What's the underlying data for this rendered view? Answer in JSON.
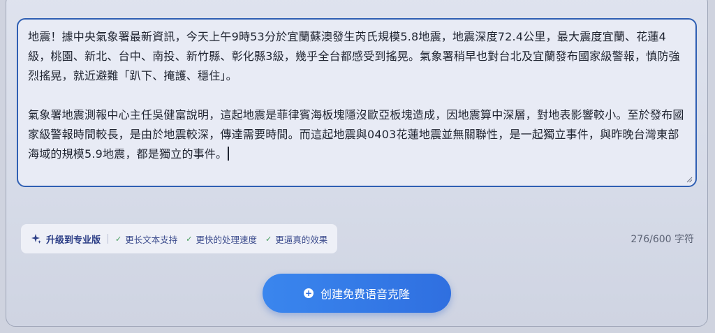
{
  "editor": {
    "paragraph_1": "地震！據中央氣象署最新資訊，今天上午9時53分於宜蘭蘇澳發生芮氏規模5.8地震，地震深度72.4公里，最大震度宜蘭、花蓮4級，桃園、新北、台中、南投、新竹縣、彰化縣3級，幾乎全台都感受到搖晃。氣象署稍早也對台北及宜蘭發布國家級警報，慎防強烈搖晃，就近避難「趴下、掩護、穩住」。",
    "paragraph_2": "氣象署地震測報中心主任吳健富說明，這起地震是菲律賓海板塊隱沒歐亞板塊造成，因地震算中深層，對地表影響較小。至於發布國家級警報時間較長，是由於地震較深，傳達需要時間。而這起地震與0403花蓮地震並無關聯性，是一起獨立事件，與昨晚台灣東部海域的規模5.9地震，都是獨立的事件。"
  },
  "features": {
    "upgrade_label": "升级到专业版",
    "items": [
      "更长文本支持",
      "更快的处理速度",
      "更逼真的效果"
    ],
    "check_glyph": "✓"
  },
  "char_count": "276/600 字符",
  "create_button": {
    "label": "创建免费语音克隆",
    "icon": "plus-circle-icon"
  },
  "colors": {
    "accent": "#2f6fe0",
    "border_active": "#2f5fb3",
    "check": "#3f9a55"
  }
}
